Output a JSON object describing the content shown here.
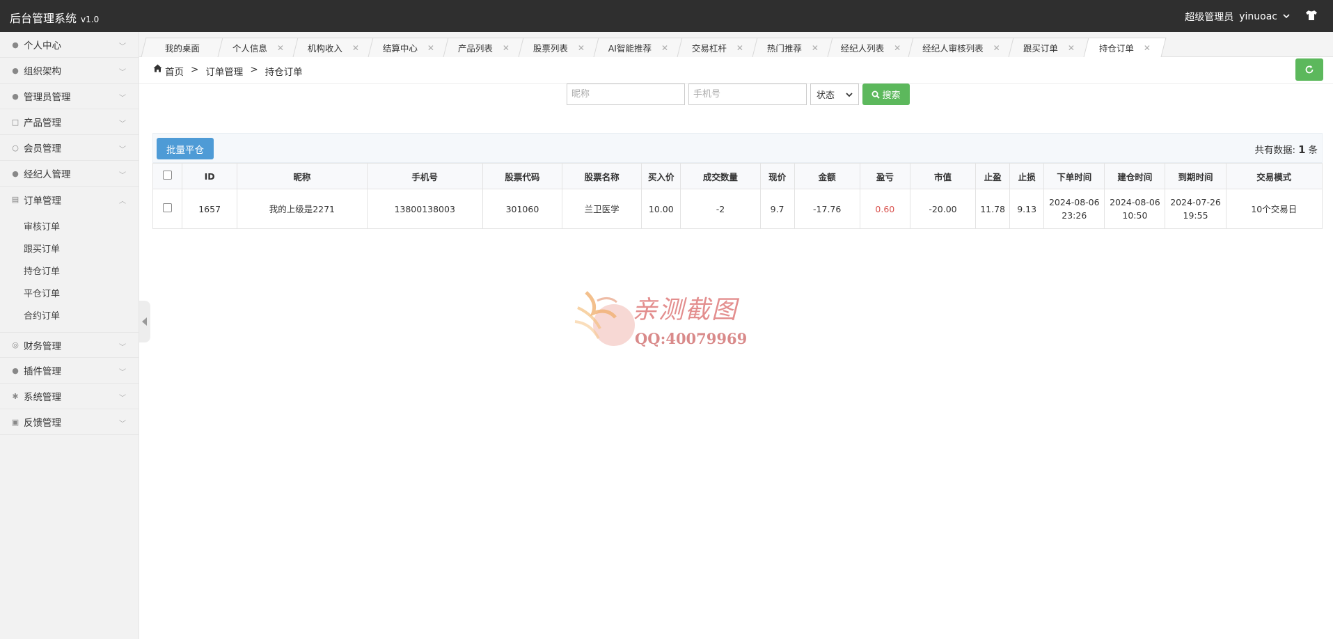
{
  "app": {
    "title": "后台管理系统",
    "version": "v1.0"
  },
  "user": {
    "role": "超级管理员",
    "name": "yinuoac"
  },
  "sidebar": {
    "items": [
      {
        "label": "个人中心",
        "icon": "user-icon"
      },
      {
        "label": "组织架构",
        "icon": "org-icon"
      },
      {
        "label": "管理员管理",
        "icon": "admin-icon"
      },
      {
        "label": "产品管理",
        "icon": "bag-icon"
      },
      {
        "label": "会员管理",
        "icon": "member-icon"
      },
      {
        "label": "经纪人管理",
        "icon": "broker-icon"
      },
      {
        "label": "订单管理",
        "icon": "order-icon"
      },
      {
        "label": "财务管理",
        "icon": "finance-icon"
      },
      {
        "label": "插件管理",
        "icon": "plugin-icon"
      },
      {
        "label": "系统管理",
        "icon": "gear-icon"
      },
      {
        "label": "反馈管理",
        "icon": "feedback-icon"
      }
    ],
    "order_sub": [
      "审核订单",
      "跟买订单",
      "持仓订单",
      "平仓订单",
      "合约订单"
    ]
  },
  "tabs": [
    {
      "label": "我的桌面"
    },
    {
      "label": "个人信息"
    },
    {
      "label": "机构收入"
    },
    {
      "label": "结算中心"
    },
    {
      "label": "产品列表"
    },
    {
      "label": "股票列表"
    },
    {
      "label": "AI智能推荐"
    },
    {
      "label": "交易杠杆"
    },
    {
      "label": "热门推荐"
    },
    {
      "label": "经纪人列表"
    },
    {
      "label": "经纪人审核列表"
    },
    {
      "label": "跟买订单"
    },
    {
      "label": "持仓订单"
    }
  ],
  "breadcrumb": [
    "首页",
    ">",
    "订单管理",
    ">",
    "持仓订单"
  ],
  "search": {
    "nickname_placeholder": "昵称",
    "phone_placeholder": "手机号",
    "status_label": "状态",
    "search_label": "搜索"
  },
  "panel": {
    "batch_label": "批量平仓",
    "total_prefix": "共有数据:",
    "total_count": "1",
    "total_suffix": "条"
  },
  "table": {
    "headers": [
      "ID",
      "昵称",
      "手机号",
      "股票代码",
      "股票名称",
      "买入价",
      "成交数量",
      "现价",
      "金额",
      "盈亏",
      "市值",
      "止盈",
      "止损",
      "下单时间",
      "建仓时间",
      "到期时间",
      "交易模式"
    ],
    "row": {
      "id": "1657",
      "nickname": "我的上级是2271",
      "phone": "13800138003",
      "code": "301060",
      "name": "兰卫医学",
      "buy_price": "10.00",
      "qty": "-2",
      "cur_price": "9.7",
      "amount": "-17.76",
      "pnl": "0.60",
      "market_value": "-20.00",
      "take_profit": "11.78",
      "stop_loss": "9.13",
      "order_date": "2024-08-06",
      "order_time": "23:26",
      "open_date": "2024-08-06",
      "open_time": "10:50",
      "expire_date": "2024-07-26",
      "expire_time": "19:55",
      "mode": "10个交易日"
    }
  },
  "watermark": {
    "line1": "亲测截图",
    "line2": "QQ:40079969"
  }
}
